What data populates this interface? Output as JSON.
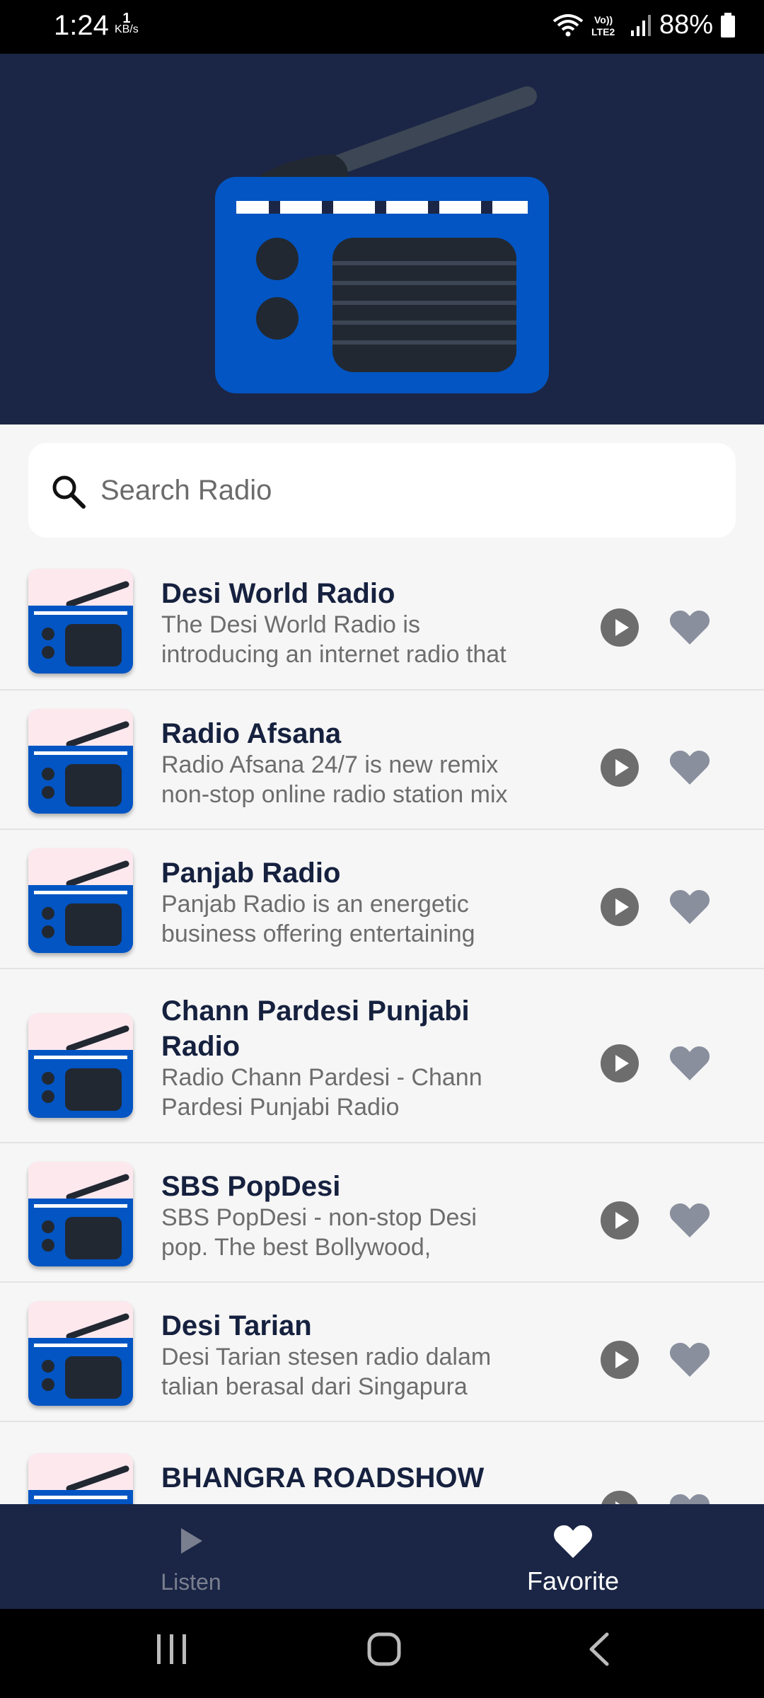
{
  "status_bar": {
    "time": "1:24",
    "net_speed_value": "1",
    "net_speed_unit": "KB/s",
    "network_label": "Vo)) LTE2",
    "battery": "88%"
  },
  "search": {
    "placeholder": "Search Radio",
    "value": ""
  },
  "stations": [
    {
      "title": "Desi World Radio",
      "desc_line1": "The Desi World Radio is",
      "desc_line2": "introducing an internet radio that"
    },
    {
      "title": "Radio Afsana",
      "desc_line1": "Radio Afsana 24/7 is new remix",
      "desc_line2": "non-stop online radio station mix"
    },
    {
      "title": "Panjab Radio",
      "desc_line1": "Panjab Radio is an energetic",
      "desc_line2": "business offering entertaining"
    },
    {
      "title_line1": "Chann Pardesi Punjabi",
      "title_line2": "Radio",
      "desc_line1": "Radio Chann Pardesi - Chann",
      "desc_line2": "Pardesi Punjabi Radio"
    },
    {
      "title": "SBS PopDesi",
      "desc_line1": "SBS PopDesi - non-stop Desi",
      "desc_line2": "pop. The best Bollywood,"
    },
    {
      "title": "Desi Tarian",
      "desc_line1": "Desi Tarian stesen radio dalam",
      "desc_line2": "talian berasal dari Singapura"
    },
    {
      "title": "BHANGRA ROADSHOW"
    }
  ],
  "bottom_nav": {
    "listen_label": "Listen",
    "favorite_label": "Favorite",
    "active": "favorite"
  },
  "icons": {
    "search": "search-icon",
    "play": "play-circle-icon",
    "favorite": "heart-icon",
    "listen": "play-icon"
  },
  "colors": {
    "header_bg": "#1b2646",
    "radio_blue": "#0255c3",
    "title_text": "#16213f",
    "icon_gray": "#8a8f9e",
    "play_gray": "#6d6d6d"
  }
}
